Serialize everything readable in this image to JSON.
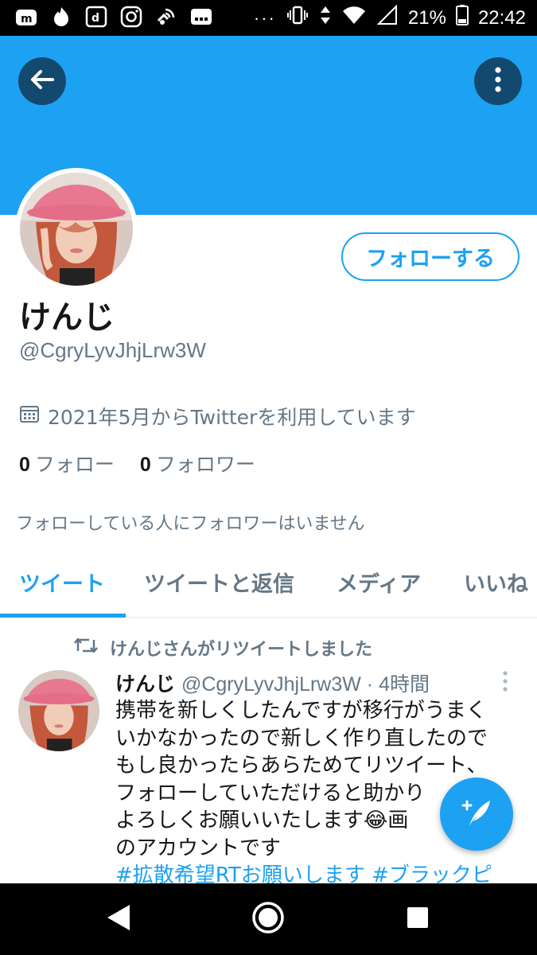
{
  "status_bar": {
    "left_icons": [
      "m-app-icon",
      "tinder-icon",
      "d-icon",
      "instagram-icon",
      "wifi-calling-icon",
      "d-card-icon"
    ],
    "overflow": "···",
    "battery": "21%",
    "time": "22:42"
  },
  "header": {
    "banner_color": "#1da1f2",
    "back_icon": "arrow-left-icon",
    "more_icon": "more-vertical-icon"
  },
  "profile": {
    "name": "けんじ",
    "handle": "@CgryLyvJhjLrw3W",
    "follow_label": "フォローする",
    "joined": "2021年5月からTwitterを利用しています",
    "following_count": "0",
    "following_label": "フォロー",
    "followers_count": "0",
    "followers_label": "フォロワー",
    "not_followed_notice": "フォローしている人にフォロワーはいません"
  },
  "tabs": [
    {
      "label": "ツイート",
      "active": true
    },
    {
      "label": "ツイートと返信",
      "active": false
    },
    {
      "label": "メディア",
      "active": false
    },
    {
      "label": "いいね",
      "active": false
    }
  ],
  "tweet": {
    "retweet_notice": "けんじさんがリツイートしました",
    "author_name": "けんじ",
    "author_meta": "@CgryLyvJhjLrw3W · 4時間",
    "lines": [
      "携帯を新しくしたんですが移行がうまく",
      "いかなかったので新しく作り直したので",
      "もし良かったらあらためてリツイート、",
      "フォローしていただけると助かり",
      "よろしくお願いいたします😂画",
      "のアカウントです"
    ],
    "hashtags": "#拡散希望RTお願いします #ブラックピ"
  },
  "fab": {
    "icon": "compose-tweet-icon"
  },
  "nav_bar": {
    "icons": [
      "back-triangle-icon",
      "home-circle-icon",
      "recents-square-icon"
    ]
  },
  "colors": {
    "accent": "#1da1f2",
    "muted": "#657786",
    "text": "#14171a"
  }
}
